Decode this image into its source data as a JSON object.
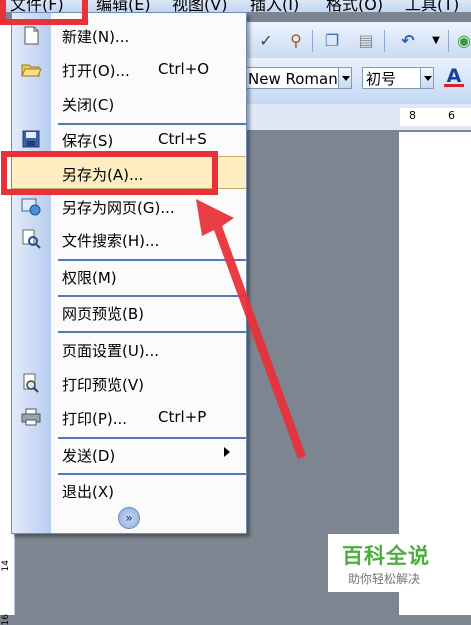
{
  "menubar": [
    "文件(F)",
    "编辑(E)",
    "视图(V)",
    "插入(I)",
    "格式(O)",
    "工具(T)"
  ],
  "toolbar": {
    "font_name": "New Roman",
    "font_size": "初号",
    "font_color_letter": "A"
  },
  "ruler": {
    "numbers": [
      "8",
      "6"
    ]
  },
  "vruler": {
    "marks": [
      "14",
      "16"
    ]
  },
  "file_menu": {
    "items": [
      {
        "label": "新建(N)...",
        "shortcut": ""
      },
      {
        "label": "打开(O)...",
        "shortcut": "Ctrl+O"
      },
      {
        "label": "关闭(C)",
        "shortcut": ""
      },
      {
        "label": "保存(S)",
        "shortcut": "Ctrl+S"
      },
      {
        "label": "另存为(A)...",
        "shortcut": ""
      },
      {
        "label": "另存为网页(G)...",
        "shortcut": ""
      },
      {
        "label": "文件搜索(H)...",
        "shortcut": ""
      },
      {
        "label": "权限(M)",
        "shortcut": ""
      },
      {
        "label": "网页预览(B)",
        "shortcut": ""
      },
      {
        "label": "页面设置(U)...",
        "shortcut": ""
      },
      {
        "label": "打印预览(V)",
        "shortcut": ""
      },
      {
        "label": "打印(P)...",
        "shortcut": "Ctrl+P"
      },
      {
        "label": "发送(D)",
        "shortcut": ""
      },
      {
        "label": "退出(X)",
        "shortcut": ""
      }
    ],
    "expand_glyph": "»"
  },
  "watermark": {
    "title": "百科全说",
    "subtitle": "助你轻松解决"
  },
  "colors": {
    "annotation_red": "#e8323a",
    "highlight": "#ffeec2",
    "separator": "#4e79c0"
  }
}
